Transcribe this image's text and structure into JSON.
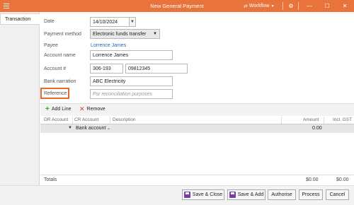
{
  "window": {
    "title": "New General Payment",
    "workflow_label": "Workflow",
    "colors": {
      "titlebar": "#e8743b",
      "highlight": "#e8672a",
      "link": "#2a63b8"
    }
  },
  "tabs": [
    {
      "label": "Transaction"
    }
  ],
  "form": {
    "date_label": "Date",
    "date_value": "14/10/2024",
    "payment_method_label": "Payment method",
    "payment_method_value": "Electronic funds transfer",
    "payee_label": "Payee",
    "payee_value": "Lorrence James",
    "account_name_label": "Account name",
    "account_name_value": "Lorrence James",
    "account_number_label": "Account #",
    "bsb_value": "306-193",
    "account_number_value": "09812345",
    "bank_narration_label": "Bank narration",
    "bank_narration_value": "ABC Electricity",
    "reference_label": "Reference",
    "reference_placeholder": "For reconciliation purposes"
  },
  "lines": {
    "add_label": "Add Line",
    "remove_label": "Remove",
    "columns": [
      "DR Account",
      "CR Account",
      "Description",
      "Amount",
      "Incl. GST"
    ],
    "group_label": "Bank account",
    "group_amount": "0.00",
    "totals_label": "Totals",
    "totals_amount": "$0.00",
    "totals_gst": "$0.00"
  },
  "footer": {
    "save_close": "Save & Close",
    "save_add": "Save & Add",
    "authorise": "Authorise",
    "process": "Process",
    "cancel": "Cancel"
  },
  "icons": [
    "menu-icon",
    "workflow-icon",
    "chevron-down-icon",
    "gear-icon",
    "minimize-icon",
    "maximize-icon",
    "close-icon",
    "calendar-dropdown-icon",
    "plus-icon",
    "remove-icon",
    "save-icon"
  ]
}
